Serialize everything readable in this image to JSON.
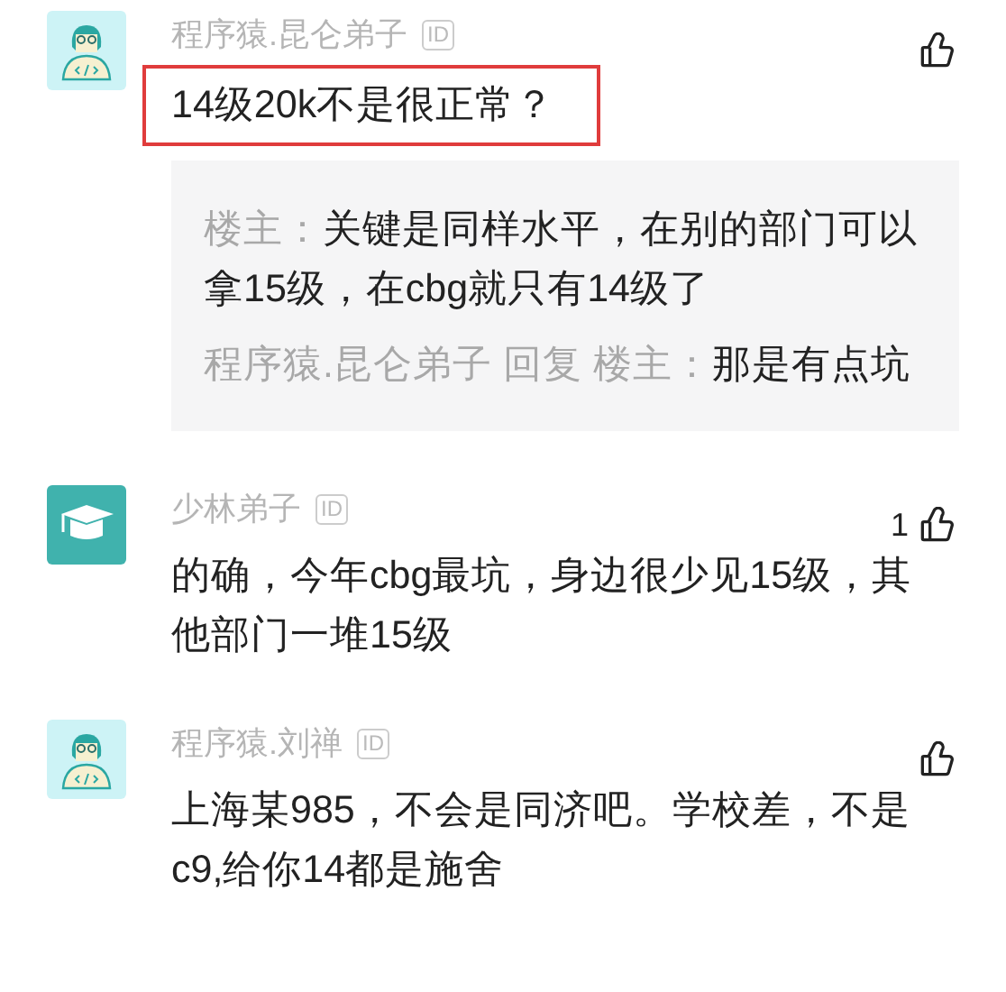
{
  "comments": [
    {
      "avatar": {
        "kind": "coder"
      },
      "name": "程序猿.昆仑弟子",
      "badge": "ID",
      "text": "14级20k不是很正常？",
      "highlighted": true,
      "replies": [
        {
          "author": "楼主：",
          "text": "关键是同样水平，在别的部门可以拿15级，在cbg就只有14级了"
        },
        {
          "author": "程序猿.昆仑弟子 回复 楼主：",
          "text": "那是有点坑"
        }
      ]
    },
    {
      "avatar": {
        "kind": "graduate"
      },
      "name": "少林弟子",
      "badge": "ID",
      "likes": "1",
      "text": "的确，今年cbg最坑，身边很少见15级，其他部门一堆15级",
      "highlighted": false
    },
    {
      "avatar": {
        "kind": "coder"
      },
      "name": "程序猿.刘禅",
      "badge": "ID",
      "text": "上海某985，不会是同济吧。学校差，不是c9,给你14都是施舍",
      "highlighted": false
    }
  ]
}
